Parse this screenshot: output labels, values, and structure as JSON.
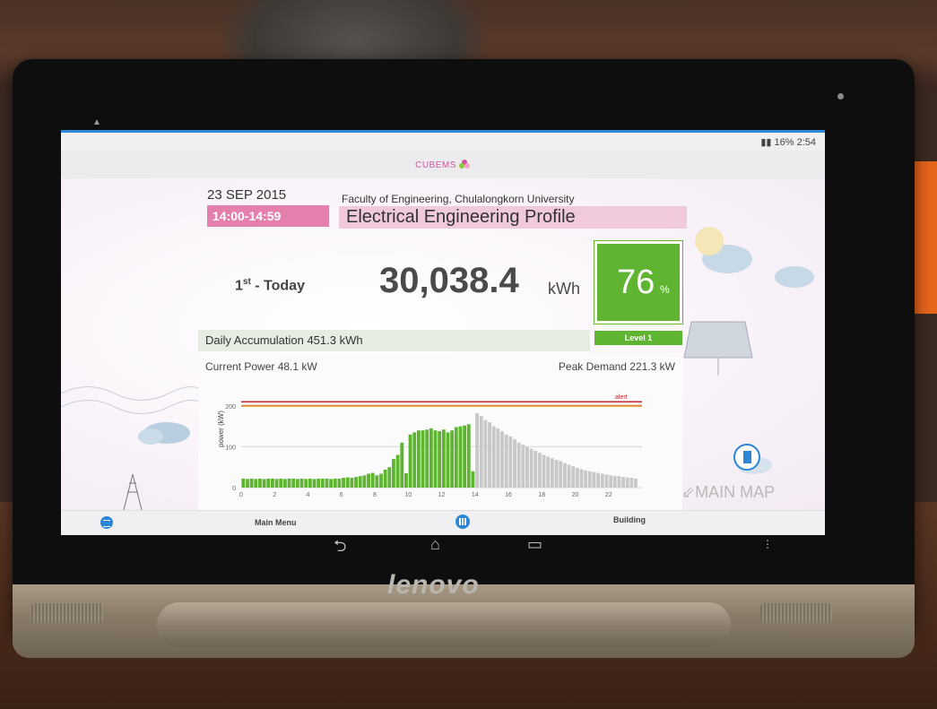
{
  "device": {
    "brand": "lenovo",
    "status_bar": "16% 2:54"
  },
  "app": {
    "logo": "CUBEMS"
  },
  "header": {
    "date": "23 SEP 2015",
    "time_range": "14:00-14:59",
    "faculty": "Faculty of Engineering, Chulalongkorn University",
    "profile_title": "Electrical Engineering Profile"
  },
  "summary": {
    "rank": "1",
    "rank_suffix": "st",
    "rank_label": "- Today",
    "energy_value": "30,038.4",
    "energy_unit": "kWh",
    "percent": "76",
    "percent_sign": "%",
    "level": "Level 1",
    "daily_accumulation": "Daily Accumulation 451.3 kWh",
    "current_power": "Current Power 48.1  kW",
    "peak_demand": "Peak Demand 221.3 kW"
  },
  "main_map_label": "MAIN MAP",
  "bottom_nav": {
    "main_menu": "Main Menu",
    "building": "Building"
  },
  "colors": {
    "accent_blue": "#2b86d6",
    "pink": "#e57fae",
    "green": "#5fb532",
    "gray_bar": "#c8c8c8",
    "alert_red": "#d33"
  },
  "chart_data": {
    "type": "bar",
    "ylabel": "power (kW)",
    "ylim": [
      0,
      250
    ],
    "yticks": [
      0,
      100,
      200
    ],
    "xticks": [
      "0",
      "2",
      "4",
      "6",
      "8",
      "10",
      "12",
      "14",
      "16",
      "18",
      "20",
      "22"
    ],
    "xlim": [
      0,
      24
    ],
    "alert_label": "alert",
    "alert_level": 200,
    "peak_level": 210,
    "bin_hours": 0.25,
    "series": [
      {
        "values": [
          22,
          21,
          22,
          21,
          22,
          21,
          22,
          22,
          21,
          22,
          21,
          22,
          22,
          21,
          22,
          21,
          22,
          21,
          22,
          22,
          22,
          21,
          22,
          22,
          24,
          25,
          24,
          26,
          28,
          30,
          34,
          36,
          30,
          34,
          44,
          50,
          70,
          80,
          110,
          35,
          130,
          135,
          140,
          140,
          142,
          145,
          140,
          138,
          142,
          135,
          140,
          148,
          150,
          152,
          155,
          40
        ]
      },
      {
        "values": [
          182,
          175,
          165,
          160,
          150,
          145,
          138,
          130,
          125,
          118,
          110,
          105,
          100,
          95,
          90,
          85,
          80,
          76,
          72,
          68,
          65,
          60,
          56,
          52,
          48,
          45,
          42,
          40,
          38,
          36,
          34,
          32,
          30,
          28,
          28,
          26,
          25,
          24,
          22
        ]
      }
    ]
  }
}
